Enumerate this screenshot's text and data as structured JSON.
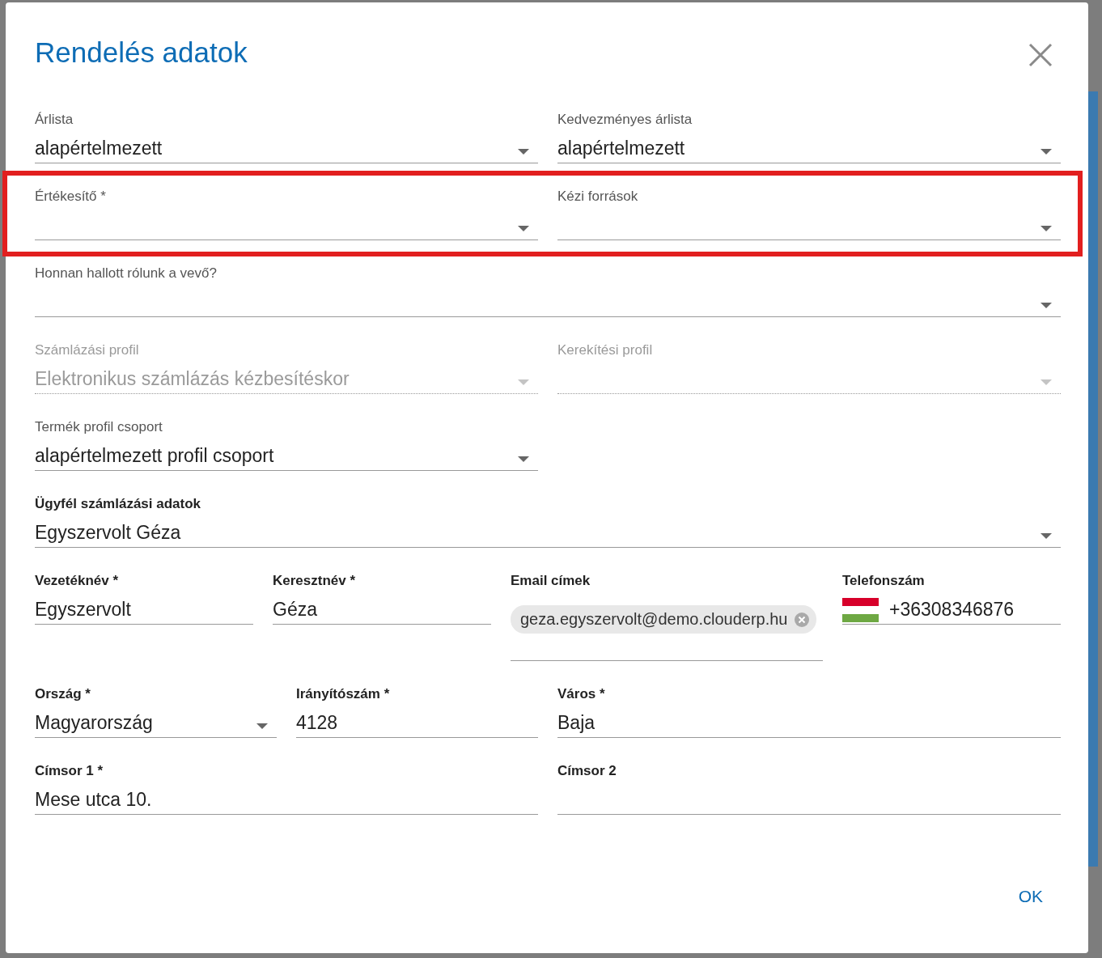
{
  "dialog": {
    "title": "Rendelés adatok",
    "ok_button": "OK"
  },
  "rows": [
    {
      "highlighted": false,
      "fields": [
        {
          "kind": "select",
          "label": "Árlista",
          "label_bold": false,
          "disabled": false,
          "value": "alapértelmezett"
        },
        {
          "kind": "select",
          "label": "Kedvezményes árlista",
          "label_bold": false,
          "disabled": false,
          "value": "alapértelmezett"
        }
      ]
    },
    {
      "highlighted": true,
      "fields": [
        {
          "kind": "select",
          "label": "Értékesítő *",
          "label_bold": false,
          "disabled": false
        },
        {
          "kind": "select",
          "label": "Kézi források",
          "label_bold": false,
          "disabled": false
        }
      ]
    },
    {
      "highlighted": false,
      "fields": [
        {
          "kind": "select",
          "label": "Honnan hallott rólunk a vevő?",
          "label_bold": false,
          "disabled": false
        }
      ]
    },
    {
      "highlighted": false,
      "fields": [
        {
          "kind": "select",
          "label": "Számlázási profil",
          "label_bold": false,
          "disabled": true,
          "value": "Elektronikus számlázás kézbesítéskor"
        },
        {
          "kind": "select",
          "label": "Kerekítési profil",
          "label_bold": false,
          "disabled": true
        }
      ]
    },
    {
      "highlighted": false,
      "fields": [
        {
          "kind": "select",
          "label": "Termék profil csoport",
          "label_bold": false,
          "disabled": false,
          "value": "alapértelmezett profil csoport"
        }
      ]
    },
    {
      "highlighted": false,
      "fields": [
        {
          "kind": "select",
          "label": "Ügyfél számlázási adatok",
          "label_bold": true,
          "disabled": false,
          "value": "Egyszervolt Géza"
        }
      ]
    },
    {
      "highlighted": false,
      "fields": [
        {
          "kind": "text",
          "label": "Vezetéknév *",
          "label_bold": true,
          "disabled": false,
          "value": "Egyszervolt"
        },
        {
          "kind": "text",
          "label": "Keresztnév *",
          "label_bold": true,
          "disabled": false,
          "value": "Géza"
        },
        {
          "kind": "email",
          "label": "Email címek",
          "label_bold": true,
          "disabled": false,
          "chips": [
            "geza.egyszervolt@demo.clouderp.hu"
          ]
        },
        {
          "kind": "phone",
          "label": "Telefonszám",
          "label_bold": true,
          "disabled": false,
          "value": "+36308346876"
        }
      ]
    },
    {
      "highlighted": false,
      "fields": [
        {
          "kind": "select",
          "label": "Ország *",
          "label_bold": true,
          "disabled": false,
          "value": "Magyarország"
        },
        {
          "kind": "text",
          "label": "Irányítószám *",
          "label_bold": true,
          "disabled": false,
          "value": "4128"
        },
        {
          "kind": "text",
          "label": "Város *",
          "label_bold": true,
          "disabled": false,
          "value": "Baja"
        }
      ]
    },
    {
      "highlighted": false,
      "fields": [
        {
          "kind": "text",
          "label": "Címsor 1 *",
          "label_bold": true,
          "disabled": false,
          "value": "Mese utca 10."
        },
        {
          "kind": "text",
          "label": "Címsor 2",
          "label_bold": true,
          "disabled": false
        }
      ]
    }
  ]
}
